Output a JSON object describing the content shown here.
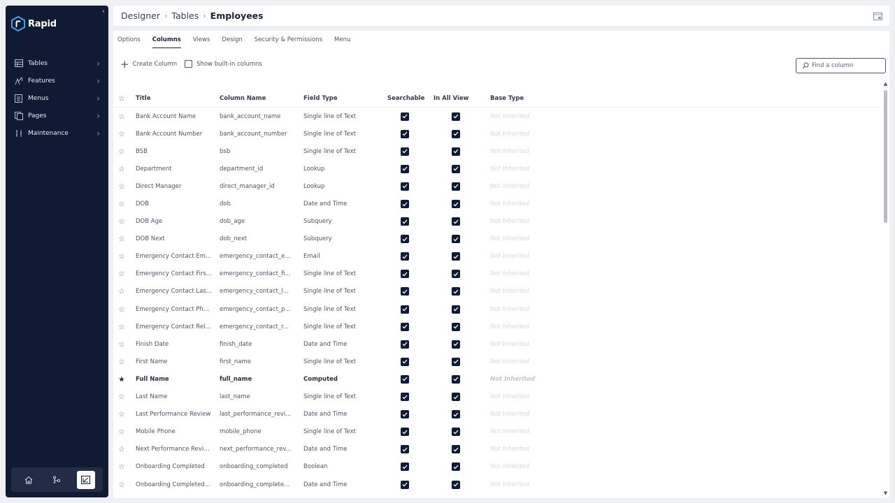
{
  "app": {
    "name": "Rapid"
  },
  "sidebar": {
    "items": [
      {
        "label": "Tables",
        "icon": "table-icon"
      },
      {
        "label": "Features",
        "icon": "features-icon"
      },
      {
        "label": "Menus",
        "icon": "menu-icon"
      },
      {
        "label": "Pages",
        "icon": "pages-icon"
      },
      {
        "label": "Maintenance",
        "icon": "maintenance-icon"
      }
    ],
    "bottom": [
      "home-icon",
      "flow-icon",
      "designer-icon"
    ]
  },
  "breadcrumb": {
    "items": [
      "Designer",
      "Tables"
    ],
    "current": "Employees"
  },
  "tabs": [
    "Options",
    "Columns",
    "Views",
    "Design",
    "Security & Permissions",
    "Menu"
  ],
  "active_tab": "Columns",
  "toolbar": {
    "create_label": "Create Column",
    "show_builtin_label": "Show built-in columns"
  },
  "search": {
    "placeholder": "Find a column"
  },
  "table": {
    "headers": {
      "title": "Title",
      "column_name": "Column Name",
      "field_type": "Field Type",
      "searchable": "Searchable",
      "in_all_view": "In All View",
      "base_type": "Base Type"
    },
    "rows": [
      {
        "title": "Bank Account Name",
        "column": "bank_account_name",
        "type": "Single line of Text",
        "base": "Not Inherited"
      },
      {
        "title": "Bank Account Number",
        "column": "bank_account_number",
        "type": "Single line of Text",
        "base": "Not Inherited"
      },
      {
        "title": "BSB",
        "column": "bsb",
        "type": "Single line of Text",
        "base": "Not Inherited"
      },
      {
        "title": "Department",
        "column": "department_id",
        "type": "Lookup",
        "base": "Not Inherited"
      },
      {
        "title": "Direct Manager",
        "column": "direct_manager_id",
        "type": "Lookup",
        "base": "Not Inherited"
      },
      {
        "title": "DOB",
        "column": "dob",
        "type": "Date and Time",
        "base": "Not Inherited"
      },
      {
        "title": "DOB Age",
        "column": "dob_age",
        "type": "Subquery",
        "base": "Not Inherited"
      },
      {
        "title": "DOB Next",
        "column": "dob_next",
        "type": "Subquery",
        "base": "Not Inherited"
      },
      {
        "title": "Emergency Contact Em...",
        "column": "emergency_contact_e...",
        "type": "Email",
        "base": "Not Inherited"
      },
      {
        "title": "Emergency Contact Firs...",
        "column": "emergency_contact_fi...",
        "type": "Single line of Text",
        "base": "Not Inherited"
      },
      {
        "title": "Emergency Contact Las...",
        "column": "emergency_contact_l...",
        "type": "Single line of Text",
        "base": "Not Inherited"
      },
      {
        "title": "Emergency Contact Ph...",
        "column": "emergency_contact_p...",
        "type": "Single line of Text",
        "base": "Not Inherited"
      },
      {
        "title": "Emergency Contact Rel...",
        "column": "emergency_contact_r...",
        "type": "Single line of Text",
        "base": "Not Inherited"
      },
      {
        "title": "Finish Date",
        "column": "finish_date",
        "type": "Date and Time",
        "base": "Not Inherited"
      },
      {
        "title": "First Name",
        "column": "first_name",
        "type": "Single line of Text",
        "base": "Not Inherited"
      },
      {
        "title": "Full Name",
        "column": "full_name",
        "type": "Computed",
        "base": "Not Inherited",
        "starred": true
      },
      {
        "title": "Last Name",
        "column": "last_name",
        "type": "Single line of Text",
        "base": "Not Inherited"
      },
      {
        "title": "Last Performance Review",
        "column": "last_performance_revi...",
        "type": "Date and Time",
        "base": "Not Inherited"
      },
      {
        "title": "Mobile Phone",
        "column": "mobile_phone",
        "type": "Single line of Text",
        "base": "Not Inherited"
      },
      {
        "title": "Next Performance Revie...",
        "column": "next_performance_rev...",
        "type": "Date and Time",
        "base": "Not Inherited"
      },
      {
        "title": "Onboarding Completed",
        "column": "onboarding_completed",
        "type": "Boolean",
        "base": "Not Inherited"
      },
      {
        "title": "Onboarding Completed...",
        "column": "onboarding_complete...",
        "type": "Date and Time",
        "base": "Not Inherited"
      }
    ]
  },
  "colors": {
    "sidebar_bg": "#111a33",
    "checkbox": "#111a33",
    "background": "#eef0f3"
  }
}
